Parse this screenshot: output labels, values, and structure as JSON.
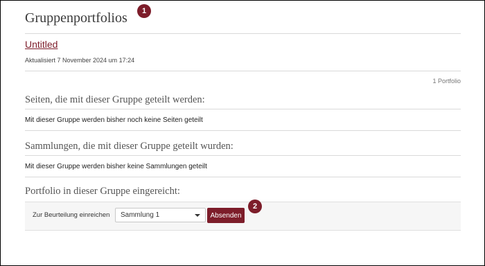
{
  "page": {
    "title": "Gruppenportfolios"
  },
  "markers": [
    "1",
    "2"
  ],
  "portfolio": {
    "title": "Untitled",
    "updated": "Aktualisiert 7 November 2024 um 17:24",
    "count": "1 Portfolio"
  },
  "pages_section": {
    "heading": "Seiten, die mit dieser Gruppe geteilt werden:",
    "text": "Mit dieser Gruppe werden bisher noch keine Seiten geteilt"
  },
  "collections_section": {
    "heading": "Sammlungen, die mit dieser Gruppe geteilt wurden:",
    "text": "Mit dieser Gruppe werden bisher keine Sammlungen geteilt"
  },
  "submitted_section": {
    "heading": "Portfolio in dieser Gruppe eingereicht:",
    "submit_label": "Zur Beurteilung einreichen",
    "select_value": "Sammlung 1",
    "button_label": "Absenden"
  },
  "colors": {
    "accent": "#7d1d2a",
    "divider": "#d9d9d9"
  }
}
